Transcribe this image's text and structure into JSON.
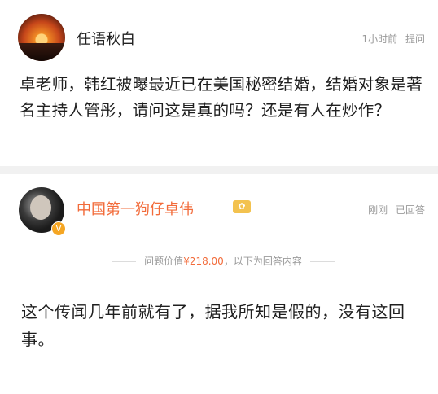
{
  "question": {
    "asker_name": "任语秋白",
    "time": "1小时前",
    "label": "提问",
    "text": "卓老师，韩红被曝最近已在美国秘密结婚，结婚对象是著名主持人管彤，请问这是真的吗？还是有人在炒作？"
  },
  "answer": {
    "answerer_name": "中国第一狗仔卓伟",
    "badge": "V",
    "crown": "✿",
    "time": "刚刚",
    "status": "已回答",
    "price_prefix": "问题价值",
    "price": "¥218.00",
    "price_suffix": "，以下为回答内容",
    "text": "这个传闻几年前就有了，据我所知是假的，没有这回事。"
  },
  "colors": {
    "accent": "#f26b3a",
    "muted": "#9a9a9a",
    "badge": "#f5a623"
  }
}
